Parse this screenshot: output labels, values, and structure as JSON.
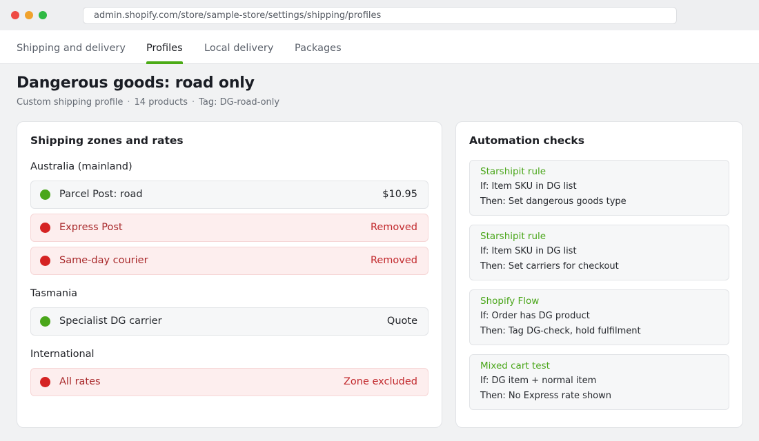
{
  "browser": {
    "url": "admin.shopify.com/store/sample-store/settings/shipping/profiles"
  },
  "tabs": [
    {
      "label": "Shipping and delivery",
      "active": false
    },
    {
      "label": "Profiles",
      "active": true
    },
    {
      "label": "Local delivery",
      "active": false
    },
    {
      "label": "Packages",
      "active": false
    }
  ],
  "header": {
    "title": "Dangerous goods: road only",
    "meta": [
      "Custom shipping profile",
      "14 products",
      "Tag: DG-road-only"
    ]
  },
  "zones_card": {
    "title": "Shipping zones and rates",
    "zones": [
      {
        "name": "Australia (mainland)",
        "rates": [
          {
            "name": "Parcel Post: road",
            "value": "$10.95",
            "status": "active"
          },
          {
            "name": "Express Post",
            "value": "Removed",
            "status": "removed"
          },
          {
            "name": "Same-day courier",
            "value": "Removed",
            "status": "removed"
          }
        ]
      },
      {
        "name": "Tasmania",
        "rates": [
          {
            "name": "Specialist DG carrier",
            "value": "Quote",
            "status": "active"
          }
        ]
      },
      {
        "name": "International",
        "rates": [
          {
            "name": "All rates",
            "value": "Zone excluded",
            "status": "removed"
          }
        ]
      }
    ]
  },
  "automation_card": {
    "title": "Automation checks",
    "checks": [
      {
        "title": "Starshipit rule",
        "if": "If: Item SKU in DG list",
        "then": "Then: Set dangerous goods type"
      },
      {
        "title": "Starshipit rule",
        "if": "If: Item SKU in DG list",
        "then": "Then: Set carriers for checkout"
      },
      {
        "title": "Shopify Flow",
        "if": "If: Order has DG product",
        "then": "Then: Tag DG-check, hold fulfilment"
      },
      {
        "title": "Mixed cart test",
        "if": "If: DG item + normal item",
        "then": "Then: No Express rate shown"
      }
    ]
  },
  "colors": {
    "accent": "#4bab16",
    "ok": "#4aa61a",
    "removed": "#d52323"
  }
}
